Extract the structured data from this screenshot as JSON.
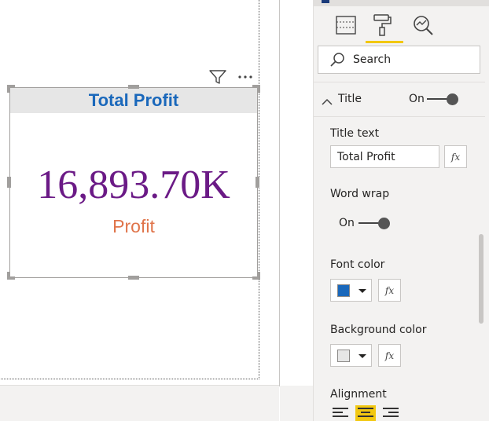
{
  "card": {
    "title": "Total Profit",
    "value": "16,893.70K",
    "label": "Profit"
  },
  "format_pane": {
    "search": {
      "label": "Search"
    },
    "title_section": {
      "label": "Title",
      "toggle_label": "On",
      "toggle_state": "on"
    },
    "title_text": {
      "label": "Title text",
      "value": "Total Profit",
      "fx_label": "fx"
    },
    "word_wrap": {
      "label": "Word wrap",
      "toggle_label": "On",
      "toggle_state": "on"
    },
    "font_color": {
      "label": "Font color",
      "value": "#1a68bb",
      "fx_label": "fx"
    },
    "background_color": {
      "label": "Background color",
      "value": "#e6e6e6",
      "fx_label": "fx"
    },
    "alignment": {
      "label": "Alignment",
      "options": [
        "align-left",
        "align-center",
        "align-right"
      ],
      "selected": "align-center"
    },
    "tabs": [
      "fields-icon",
      "format-paint-roller-icon",
      "analytics-magnifier-icon"
    ],
    "active_tab": "format-paint-roller-icon"
  },
  "colors": {
    "accent_yellow": "#f2c811",
    "card_value": "#6b1a86",
    "card_label": "#e0744a",
    "card_title": "#1a68bb"
  }
}
